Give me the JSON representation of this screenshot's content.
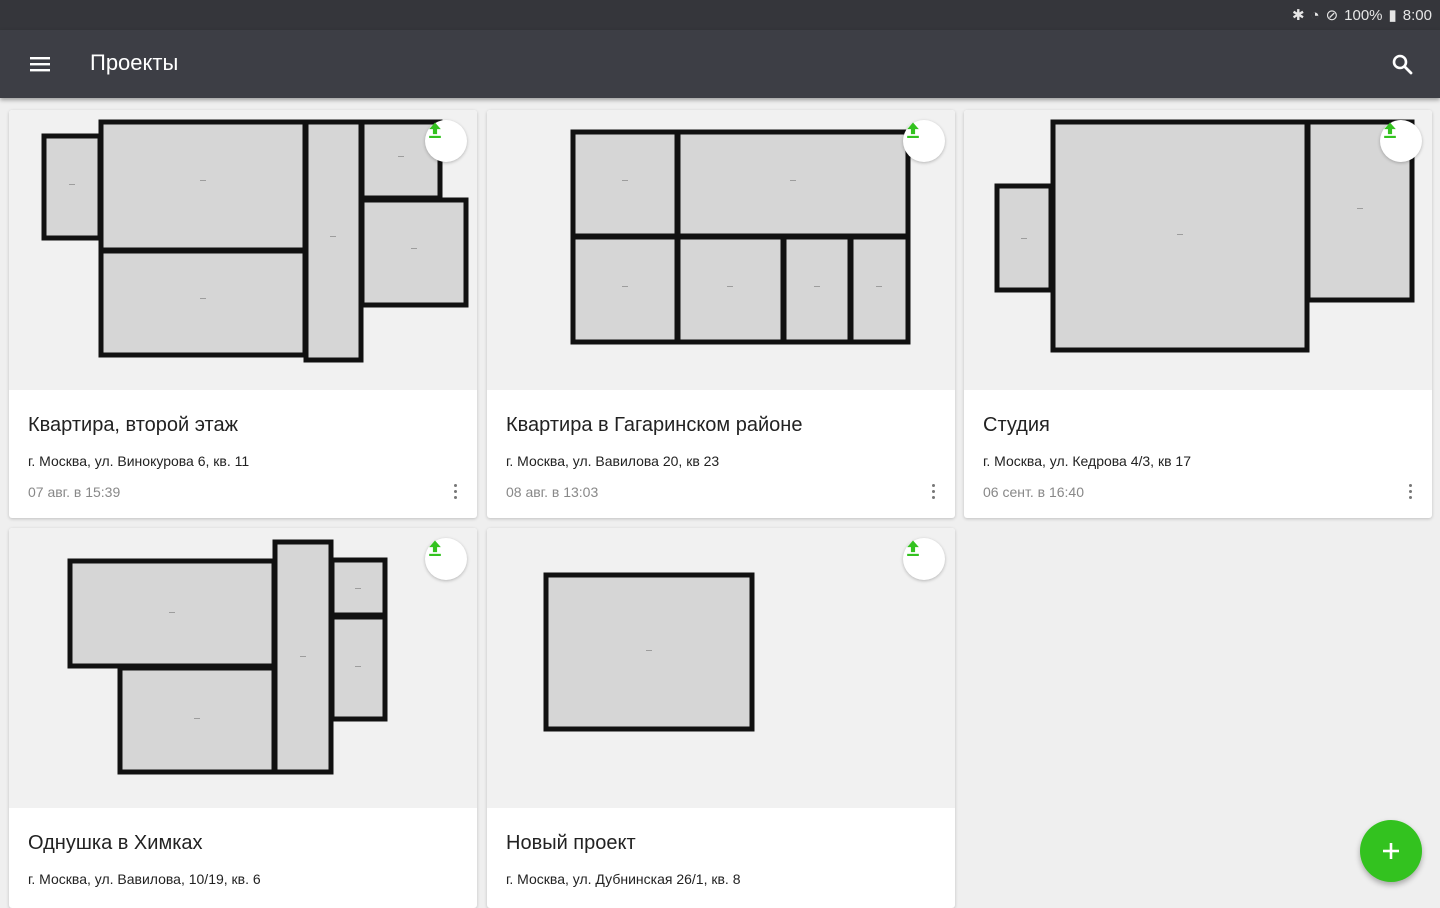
{
  "status_bar": {
    "battery": "100%",
    "time": "8:00"
  },
  "app_bar": {
    "title": "Проекты"
  },
  "projects": [
    {
      "title": "Квартира, второй этаж",
      "address": "г. Москва, ул. Винокурова 6, кв. 11",
      "date": "07 авг. в 15:39"
    },
    {
      "title": "Квартира в Гагаринском районе",
      "address": "г. Москва, ул. Вавилова 20, кв 23",
      "date": "08 авг. в 13:03"
    },
    {
      "title": "Студия",
      "address": "г. Москва, ул. Кедрова 4/3, кв 17",
      "date": "06 сент. в 16:40"
    },
    {
      "title": "Однушка в Химках",
      "address": "г. Москва, ул. Вавилова, 10/19, кв. 6",
      "date": ""
    },
    {
      "title": "Новый проект",
      "address": "г. Москва, ул. Дубнинская 26/1, кв. 8",
      "date": ""
    }
  ],
  "colors": {
    "appbar": "#3d3e45",
    "statusbar": "#35363b",
    "accent": "#33c21f"
  }
}
